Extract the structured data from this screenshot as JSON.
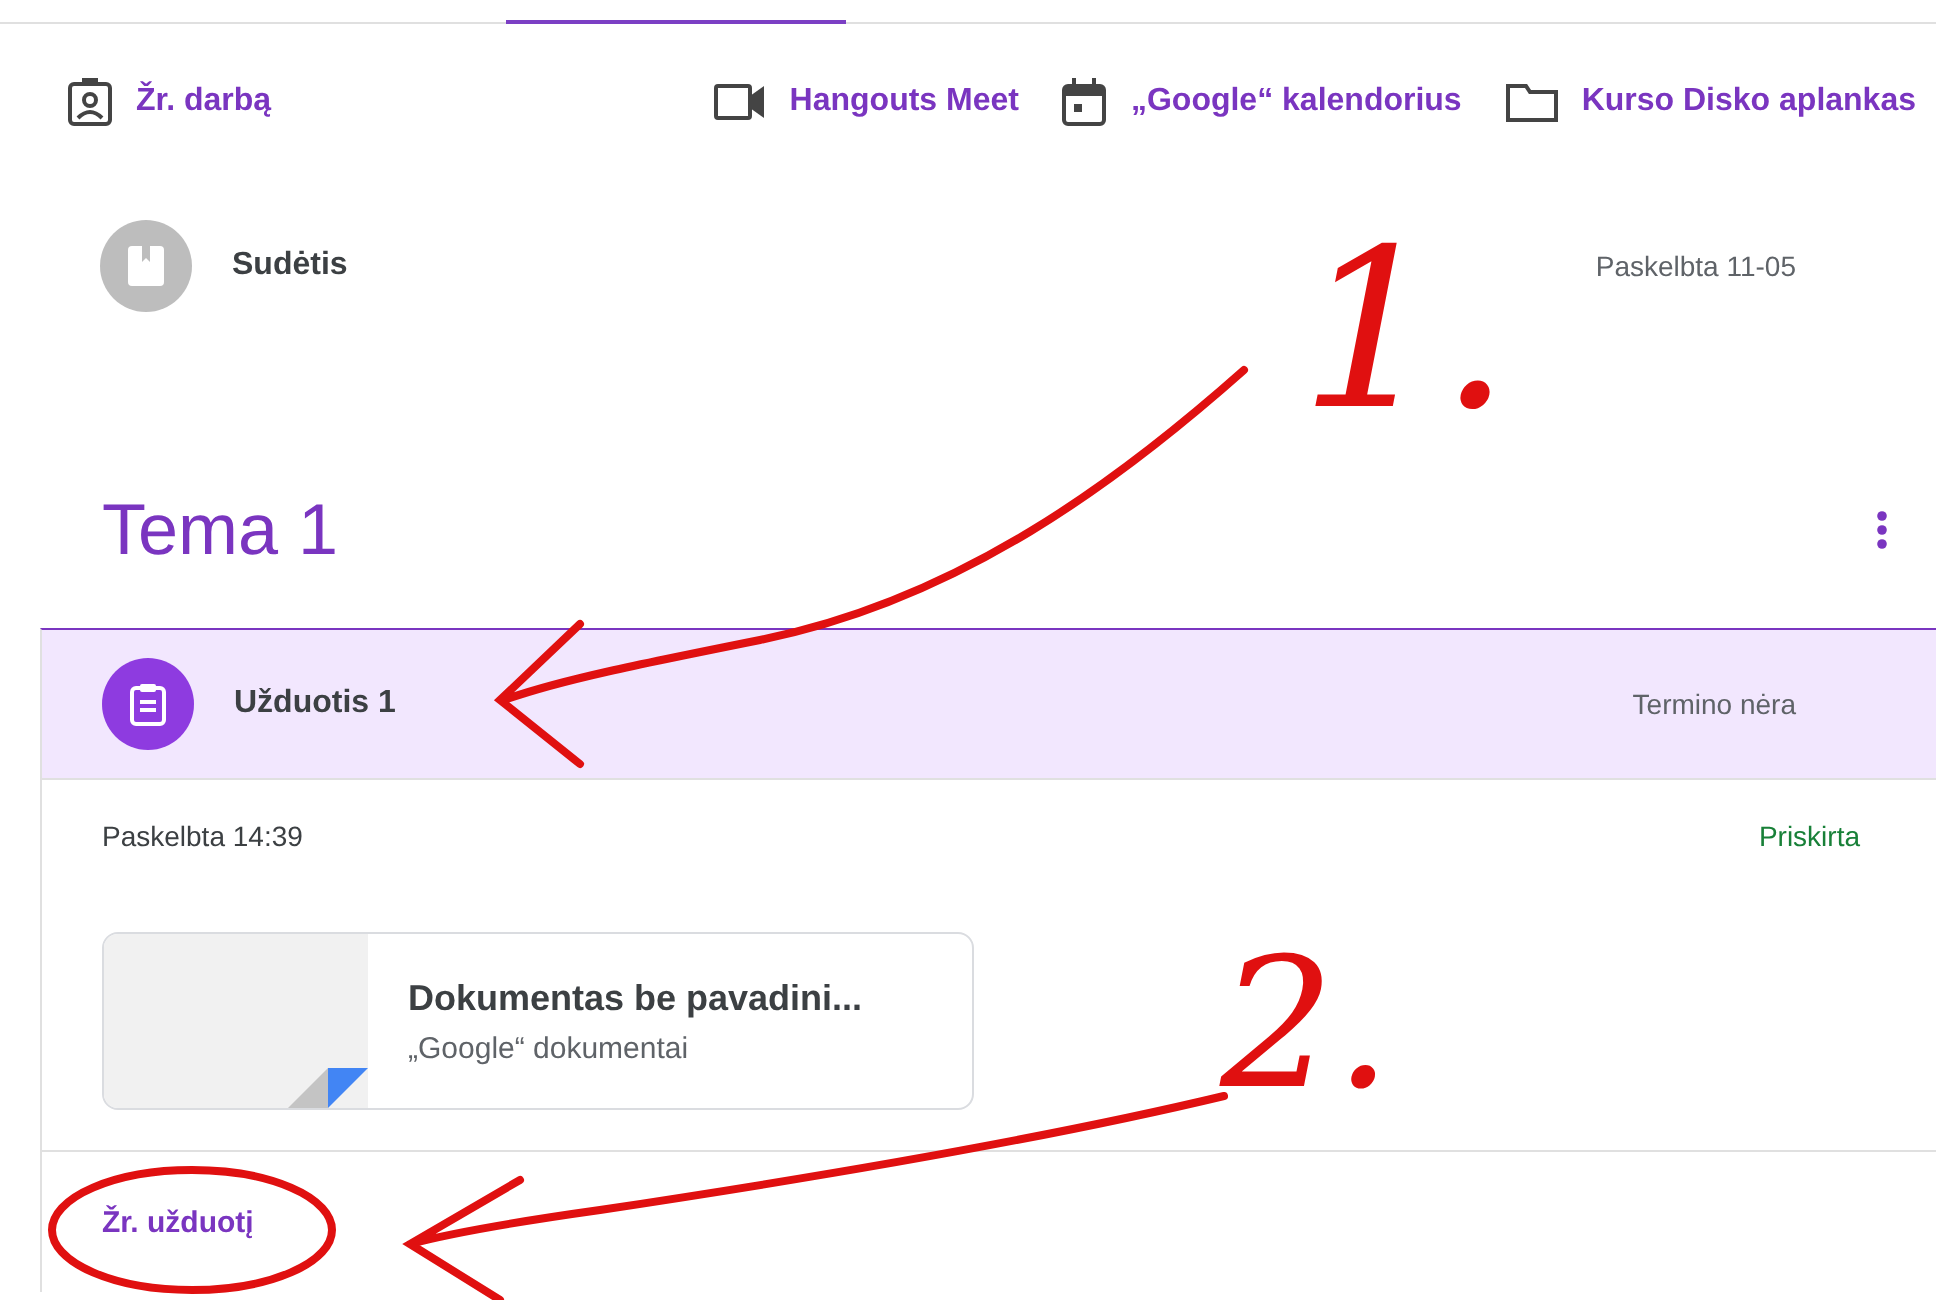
{
  "toolbar": {
    "view_work": "Žr. darbą",
    "links": [
      {
        "kind": "video",
        "label": "Hangouts Meet"
      },
      {
        "kind": "calendar",
        "label": "„Google“ kalendorius"
      },
      {
        "kind": "folder",
        "label": "Kurso Disko aplankas"
      }
    ]
  },
  "material": {
    "title": "Sudėtis",
    "posted": "Paskelbta 11-05"
  },
  "topic": {
    "title": "Tema 1"
  },
  "assignment": {
    "title": "Užduotis 1",
    "due": "Termino nėra",
    "posted": "Paskelbta 14:39",
    "status": "Priskirta",
    "attachment": {
      "title": "Dokumentas be pavadini...",
      "type": "„Google“ dokumentai"
    },
    "action": "Žr. užduotį"
  },
  "annotations": [
    {
      "label": "1."
    },
    {
      "label": "2."
    }
  ]
}
